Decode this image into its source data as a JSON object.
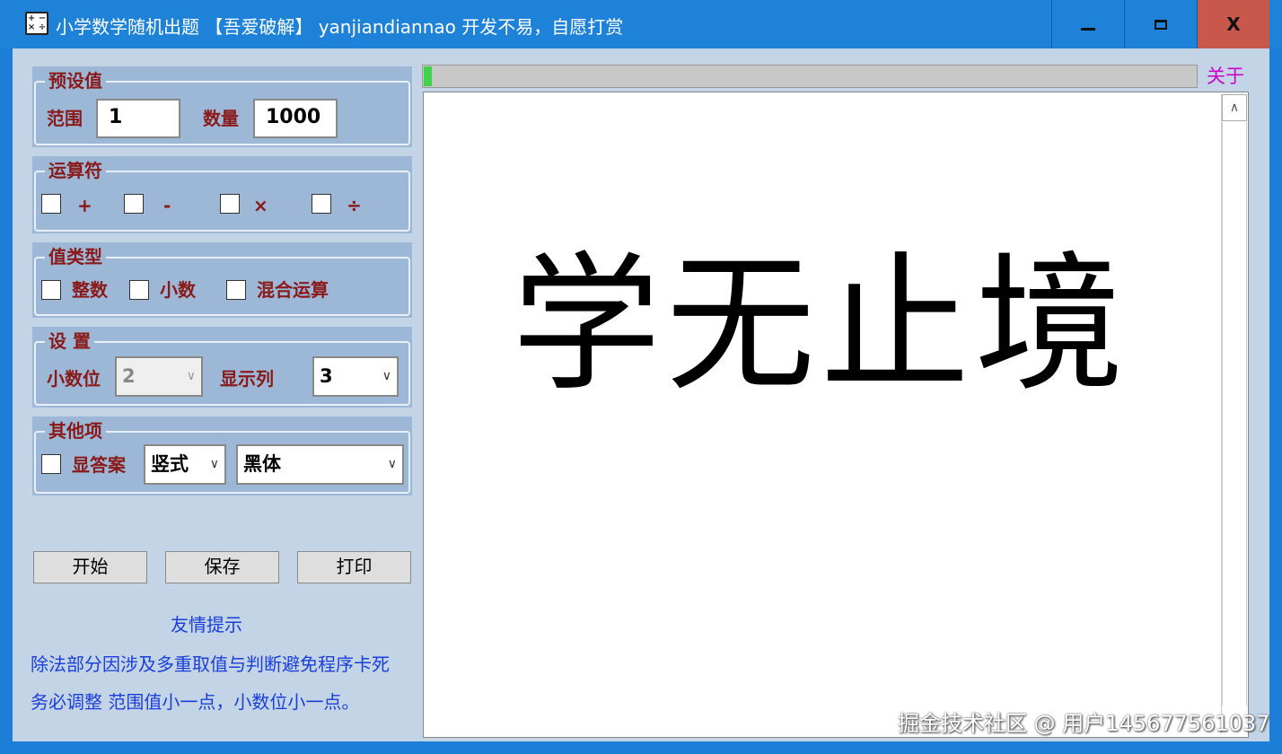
{
  "window": {
    "title": "小学数学随机出题 【吾爱破解】 yanjiandiannao 开发不易，自愿打赏",
    "icon_name": "calculator-icon",
    "minimize_glyph": "",
    "close_glyph": "X"
  },
  "preset": {
    "title": "预设值",
    "range_label": "范围",
    "range_value": "1",
    "count_label": "数量",
    "count_value": "1000"
  },
  "operators": {
    "title": "运算符",
    "items": [
      {
        "label": "+",
        "checked": false
      },
      {
        "label": "-",
        "checked": false
      },
      {
        "label": "×",
        "checked": false
      },
      {
        "label": "÷",
        "checked": false
      }
    ]
  },
  "value_type": {
    "title": "值类型",
    "items": [
      {
        "label": "整数",
        "checked": false
      },
      {
        "label": "小数",
        "checked": false
      },
      {
        "label": "混合运算",
        "checked": false
      }
    ]
  },
  "settings": {
    "title": "设 置",
    "decimal_label": "小数位",
    "decimal_value": "2",
    "columns_label": "显示列",
    "columns_value": "3"
  },
  "other": {
    "title": "其他项",
    "show_answer_label": "显答案",
    "layout_value": "竖式",
    "font_value": "黑体"
  },
  "actions": {
    "start": "开始",
    "save": "保存",
    "print": "打印"
  },
  "tips": {
    "title": "友情提示",
    "line1": "除法部分因涉及多重取值与判断避免程序卡死",
    "line2": "务必调整  范围值小一点，小数位小一点。"
  },
  "progress": {
    "value": 0.01
  },
  "about_link": "关于",
  "output": {
    "text": "学无止境"
  },
  "watermark": "掘金技术社区 @ 用户1456775610​37",
  "colors": {
    "titlebar": "#1e82d8",
    "close_button": "#c8574c",
    "group_bg": "#9cb8d6",
    "label_red": "#8a1a1a",
    "tip_blue": "#1a3fd8",
    "about_magenta": "#cc00cc",
    "progress_fill": "#3fd44a"
  }
}
